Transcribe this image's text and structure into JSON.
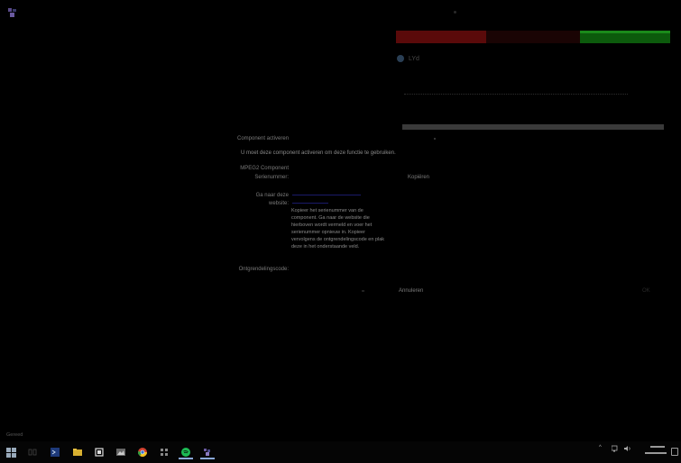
{
  "header": {
    "app_icon": "app-logo-icon"
  },
  "panel": {
    "brand_text": "LYd",
    "brand_logo": "brand-logo-icon",
    "colors": {
      "bar_red": "#5a0a0a",
      "bar_green": "#0c5a0c",
      "progress": "#3a3a3a"
    }
  },
  "dialog": {
    "title": "Component activeren",
    "message": "U moet deze component activeren om deze functie te gebruiken.",
    "component_label": "MPEG2 Component",
    "serial_label": "Serienummer:",
    "site_label": "Ga naar deze website:",
    "instructions": "Kopieer het serienummer van de component. Ga naar de website die hierboven wordt vermeld en voer het serienummer opnieuw in. Kopieer vervolgens de ontgrendelingscode en plak deze in het onderstaande veld.",
    "code_label": "Ontgrendelingscode:",
    "copy_button": "Kopiëren",
    "cancel_button": "Annuleren",
    "ok_button": "OK"
  },
  "statusbar": {
    "text": "Gereed"
  },
  "taskbar": {
    "start_icon": "windows-start-icon",
    "apps": [
      "task-view-icon",
      "powershell-icon",
      "file-explorer-icon",
      "office-icon",
      "photos-icon",
      "chrome-icon",
      "apps-icon",
      "spotify-icon",
      "app-logo-icon"
    ],
    "tray_icons": [
      "chevron-up-icon",
      "network-icon",
      "volume-icon"
    ],
    "notification_icon": "notification-icon"
  }
}
